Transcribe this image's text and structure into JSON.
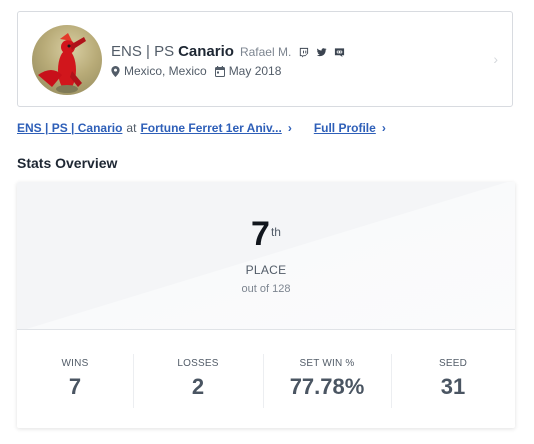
{
  "profile": {
    "prefix": "ENS | PS",
    "gamertag": "Canario",
    "real_name": "Rafael M.",
    "location": "Mexico, Mexico",
    "joined": "May 2018",
    "social_icons": [
      "twitch-icon",
      "twitter-icon",
      "discord-icon"
    ]
  },
  "links": {
    "entrant": "ENS | PS | Canario",
    "at_text": "at",
    "event": "Fortune Ferret 1er Aniv...",
    "full_profile": "Full Profile"
  },
  "stats": {
    "heading": "Stats Overview",
    "place_number": "7",
    "place_suffix": "th",
    "place_label": "PLACE",
    "place_of": "out of 128",
    "items": [
      {
        "label": "WINS",
        "value": "7"
      },
      {
        "label": "LOSSES",
        "value": "2"
      },
      {
        "label": "SET WIN %",
        "value": "77.78%"
      },
      {
        "label": "SEED",
        "value": "31"
      }
    ]
  },
  "colors": {
    "link": "#2e5fb8",
    "text_dark": "#1e2733",
    "text_muted": "#525c68"
  }
}
